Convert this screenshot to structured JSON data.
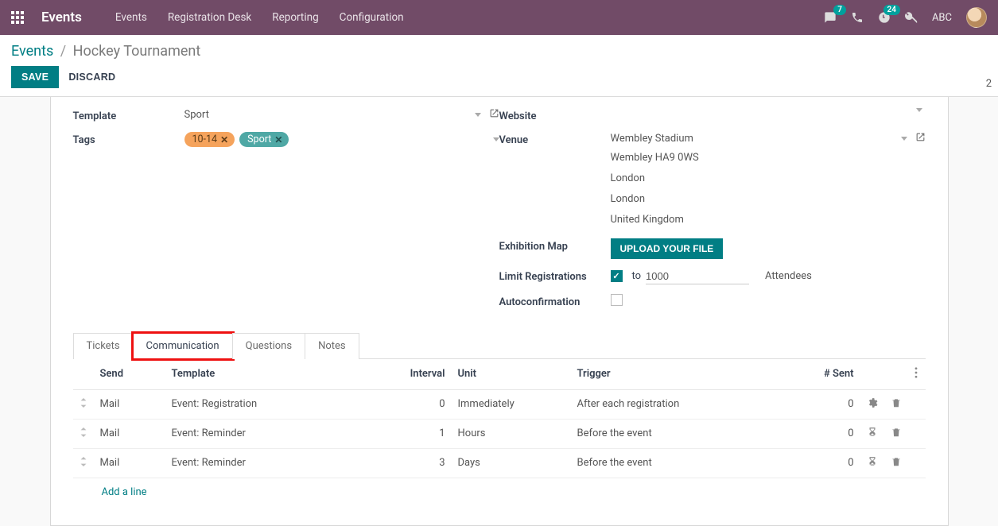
{
  "navbar": {
    "brand": "Events",
    "menu": [
      "Events",
      "Registration Desk",
      "Reporting",
      "Configuration"
    ],
    "msg_badge": "7",
    "act_badge": "24",
    "user": "ABC"
  },
  "breadcrumb": {
    "root": "Events",
    "current": "Hockey Tournament"
  },
  "buttons": {
    "save": "SAVE",
    "discard": "DISCARD"
  },
  "page_count": "2",
  "form": {
    "template_label": "Template",
    "template_value": "Sport",
    "tags_label": "Tags",
    "tags": [
      {
        "label": "10-14",
        "color": "orange"
      },
      {
        "label": "Sport",
        "color": "teal"
      }
    ],
    "website_label": "Website",
    "website_value": "",
    "venue_label": "Venue",
    "venue_value": "Wembley Stadium",
    "address": [
      "Wembley HA9 0WS",
      "London",
      "London",
      "United Kingdom"
    ],
    "exhibition_label": "Exhibition Map",
    "upload_label": "UPLOAD YOUR FILE",
    "limit_label": "Limit Registrations",
    "limit_to": "to",
    "limit_value": "1000",
    "limit_suffix": "Attendees",
    "autoconf_label": "Autoconfirmation"
  },
  "tabs": [
    "Tickets",
    "Communication",
    "Questions",
    "Notes"
  ],
  "active_tab": 1,
  "table": {
    "headers": {
      "send": "Send",
      "template": "Template",
      "interval": "Interval",
      "unit": "Unit",
      "trigger": "Trigger",
      "sent": "# Sent"
    },
    "rows": [
      {
        "send": "Mail",
        "template": "Event: Registration",
        "interval": "0",
        "unit": "Immediately",
        "trigger": "After each registration",
        "sent": "0",
        "icon": "gear"
      },
      {
        "send": "Mail",
        "template": "Event: Reminder",
        "interval": "1",
        "unit": "Hours",
        "trigger": "Before the event",
        "sent": "0",
        "icon": "hourglass"
      },
      {
        "send": "Mail",
        "template": "Event: Reminder",
        "interval": "3",
        "unit": "Days",
        "trigger": "Before the event",
        "sent": "0",
        "icon": "hourglass"
      }
    ],
    "add_line": "Add a line"
  }
}
